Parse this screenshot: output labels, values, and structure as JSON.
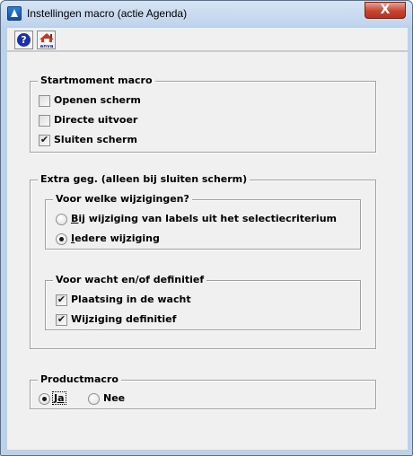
{
  "window": {
    "title": "Instellingen macro (actie Agenda)",
    "close_symbol": "X",
    "app_icon": "anva-app-icon"
  },
  "toolbar": {
    "help_symbol": "?",
    "help_icon": "help-icon",
    "anva_icon": "anva-home-icon",
    "anva_label": "anva"
  },
  "startmoment": {
    "label": "Startmoment macro",
    "options": [
      {
        "label": "Openen scherm",
        "checked": false
      },
      {
        "label": "Directe uitvoer",
        "checked": false
      },
      {
        "label": "Sluiten scherm",
        "checked": true
      }
    ]
  },
  "extra": {
    "label": "Extra geg. (alleen bij sluiten scherm)",
    "wijzigingen": {
      "label": "Voor welke wijzigingen?",
      "options": [
        {
          "accel": "B",
          "rest": "ij wijziging van labels uit het selectiecriterium",
          "selected": false
        },
        {
          "accel": "I",
          "rest": "edere wijziging",
          "selected": true
        }
      ]
    },
    "wacht": {
      "label": "Voor wacht en/of definitief",
      "options": [
        {
          "label": "Plaatsing in de wacht",
          "checked": true
        },
        {
          "label": "Wijziging definitief",
          "checked": true
        }
      ]
    }
  },
  "productmacro": {
    "label": "Productmacro",
    "options": [
      {
        "label": "Ja",
        "selected": true
      },
      {
        "label": "Nee",
        "selected": false
      }
    ]
  },
  "marks": {
    "check": "✔"
  }
}
